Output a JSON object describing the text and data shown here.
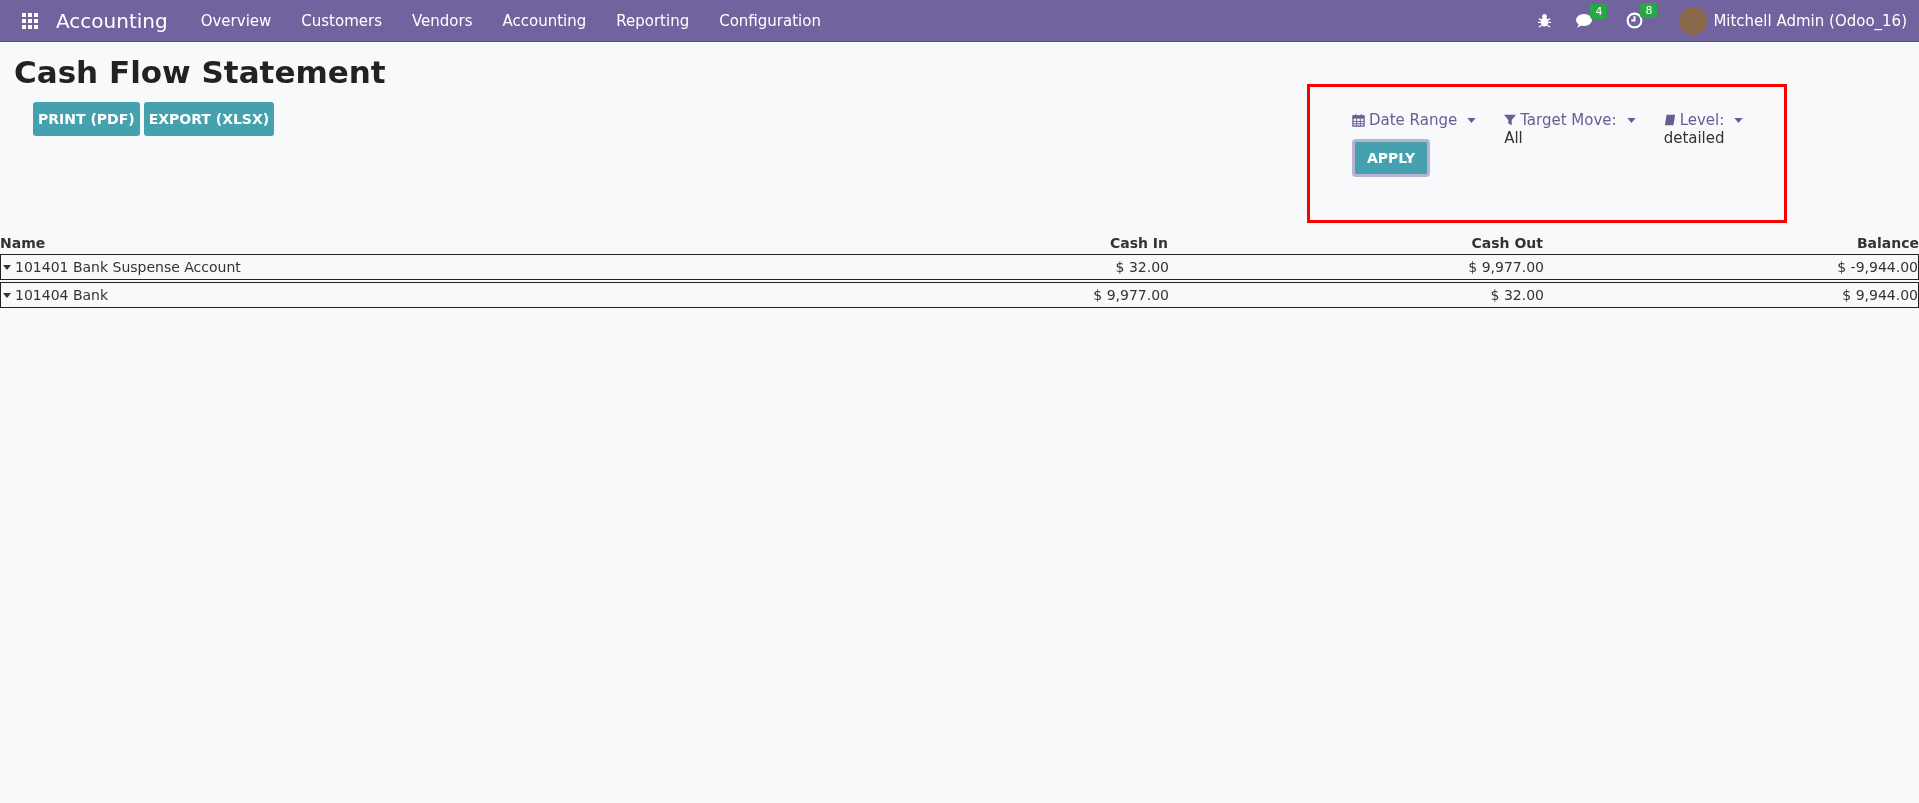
{
  "navbar": {
    "app_name": "Accounting",
    "menu": [
      "Overview",
      "Customers",
      "Vendors",
      "Accounting",
      "Reporting",
      "Configuration"
    ],
    "messages_badge": "4",
    "activities_badge": "8",
    "user": "Mitchell Admin (Odoo_16)"
  },
  "page": {
    "title": "Cash Flow Statement",
    "buttons": [
      "PRINT (PDF)",
      "EXPORT (XLSX)"
    ]
  },
  "filters": {
    "items": [
      {
        "kind": "calendar",
        "label": "Date Range"
      },
      {
        "kind": "filter",
        "label": "Target Move:",
        "value": "All"
      },
      {
        "kind": "book",
        "label": "Level:",
        "value": "detailed"
      }
    ],
    "apply": "APPLY"
  },
  "table": {
    "columns": [
      "Name",
      "Cash In",
      "Cash Out",
      "Balance"
    ],
    "rows": [
      {
        "name": "101401 Bank Suspense Account",
        "cash_in": "$ 32.00",
        "cash_out": "$ 9,977.00",
        "balance": "$ -9,944.00",
        "expanded": false
      },
      {
        "name": "101404 Bank",
        "cash_in": "$ 9,977.00",
        "cash_out": "$ 32.00",
        "balance": "$ 9,944.00",
        "expanded": false
      }
    ]
  }
}
